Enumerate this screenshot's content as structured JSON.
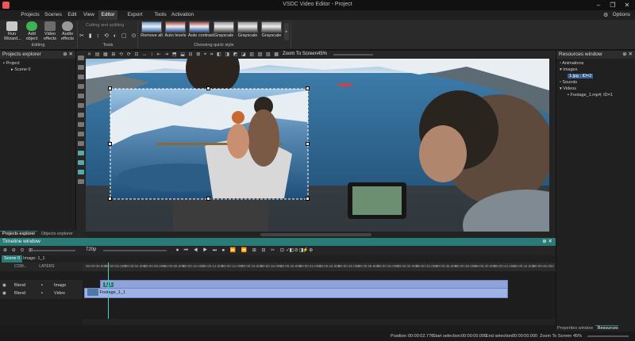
{
  "window": {
    "title": "VSDC Video Editor - Project",
    "controls": [
      "–",
      "❐",
      "✕"
    ]
  },
  "menu": {
    "items": [
      "Projects",
      "Scenes",
      "Edit",
      "View",
      "Editor",
      "Export project",
      "Tools",
      "Activation"
    ],
    "active": "Editor",
    "options_label": "Options"
  },
  "ribbon": {
    "editing": {
      "buttons": [
        {
          "label": "Run Wizard..."
        },
        {
          "label": "Add object"
        },
        {
          "label": "Video effects"
        },
        {
          "label": "Audio effects"
        }
      ],
      "title": "Editing"
    },
    "tools": {
      "title": "Tools",
      "cutting_label": "Cutting and splitting"
    },
    "quick_style": {
      "title": "Choosing quick style",
      "styles": [
        "Remove all",
        "Auto levels",
        "Auto contrast",
        "Grayscale",
        "Grayscale",
        "Grayscale"
      ]
    }
  },
  "projects_explorer": {
    "title": "Projects explorer",
    "tree": [
      "Project",
      "Scene 0"
    ],
    "tabs": [
      "Projects explorer",
      "Objects explorer"
    ]
  },
  "editor": {
    "zoom_label": "Zoom To Screen",
    "zoom_value": "45%"
  },
  "resources": {
    "title": "Resources window",
    "tree": [
      "Animations",
      "Images",
      "1.jpg ; ID=2",
      "Sounds",
      "Videos",
      "Footage_1.mp4; ID=1"
    ]
  },
  "timeline": {
    "title": "Timeline window",
    "resolution": "720p",
    "tabs": [
      "Scene 0",
      "Image: 1_1"
    ],
    "header_labels": [
      "COM...",
      "LAYERS"
    ],
    "ruler_ticks": [
      "00:00:00.000",
      "00:00:02.000",
      "00:00:04.000",
      "00:00:06.000",
      "00:00:08.000",
      "00:00:10.000",
      "00:00:12.000",
      "00:00:14.000",
      "00:00:16.000",
      "00:00:18.000",
      "00:00:20.000",
      "00:00:22.000",
      "00:00:24.000",
      "00:00:26.000",
      "00:00:28.000",
      "00:00:30.000",
      "00:00:32.000",
      "00:00:34.000",
      "00:00:36.000",
      "00:00:38.000",
      "00:00:40.000",
      "00:00:42.000",
      "00:00:44.000",
      "00:00:46.000"
    ],
    "tracks": [
      {
        "blend": "Blend",
        "type": "Image",
        "clip": "1_1"
      },
      {
        "blend": "Blend",
        "type": "Video",
        "clip": "Footage_1_1"
      }
    ]
  },
  "status": {
    "position_label": "Position:",
    "position_value": "00:00:02.776",
    "start_label": "Start selection:",
    "start_value": "00:00:00.000",
    "end_label": "End selection:",
    "end_value": "00:00:00.000",
    "zoom_label": "Zoom To Screen",
    "zoom_value": "45%"
  },
  "right_tabs": [
    "Properties window",
    "Resources window"
  ]
}
